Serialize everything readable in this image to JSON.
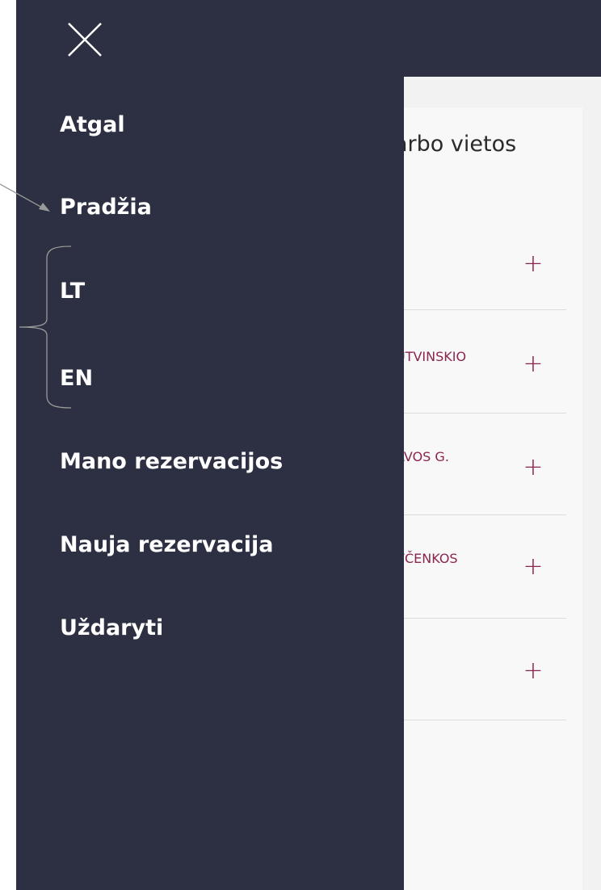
{
  "drawer": {
    "menu": [
      {
        "label": "Atgal"
      },
      {
        "label": "Pradžia"
      },
      {
        "label": "LT"
      },
      {
        "label": "EN"
      },
      {
        "label": "Mano rezervacijos"
      },
      {
        "label": "Nauja rezervacija"
      },
      {
        "label": "Uždaryti"
      }
    ]
  },
  "background": {
    "title_fragment": "arbo vietos",
    "rows": [
      {
        "text": ""
      },
      {
        "text": "UTVINSKIO"
      },
      {
        "text": "AVOS G."
      },
      {
        "text": "VČENKOS"
      },
      {
        "text": ""
      }
    ]
  },
  "colors": {
    "drawer_bg": "#2c3042",
    "accent": "#8b2550"
  }
}
